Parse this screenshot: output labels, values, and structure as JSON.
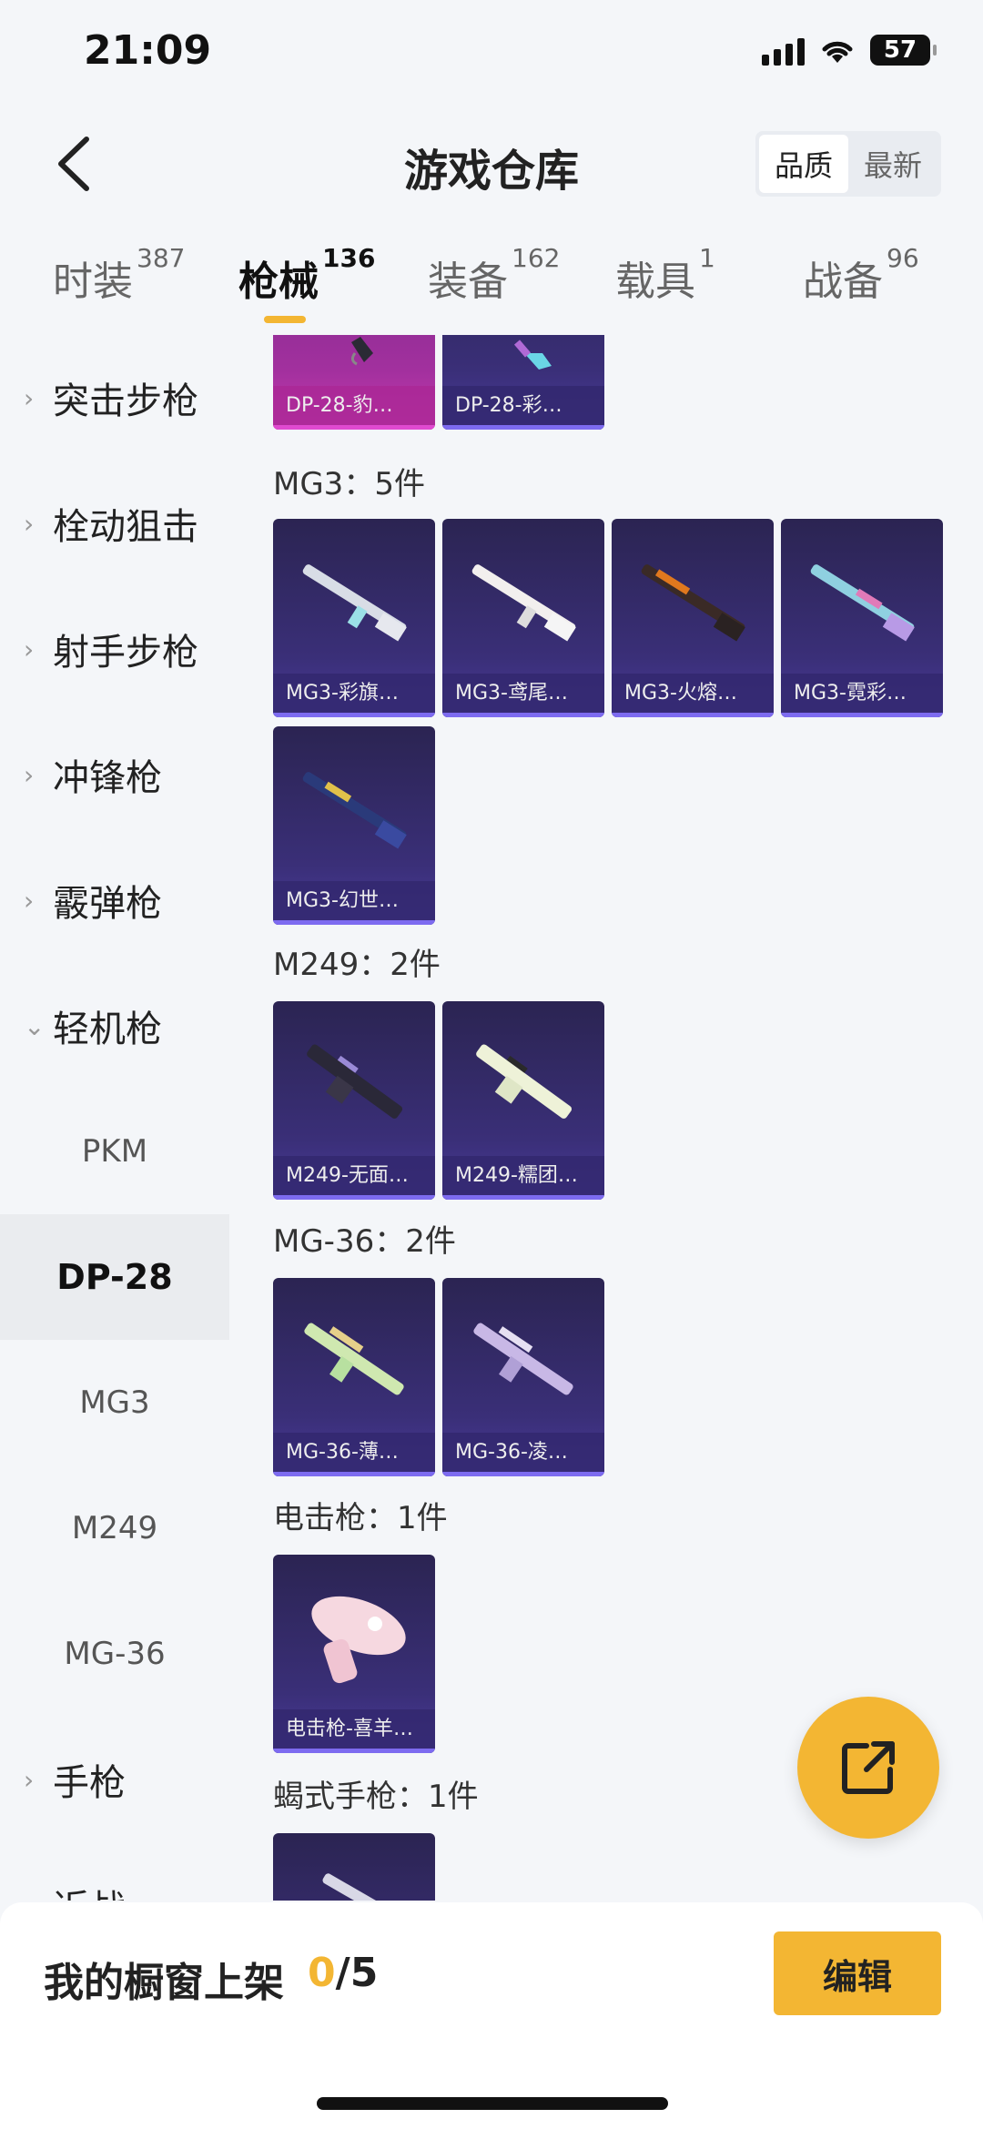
{
  "status": {
    "time": "21:09",
    "battery": "57"
  },
  "header": {
    "title": "游戏仓库",
    "sort": [
      "品质",
      "最新"
    ]
  },
  "tabs": [
    {
      "label": "时装",
      "count": "387"
    },
    {
      "label": "枪械",
      "count": "136"
    },
    {
      "label": "装备",
      "count": "162"
    },
    {
      "label": "载具",
      "count": "1"
    },
    {
      "label": "战备",
      "count": "96"
    }
  ],
  "sidebar": {
    "items": [
      {
        "label": "突击步枪",
        "chev": "›"
      },
      {
        "label": "栓动狙击",
        "chev": "›"
      },
      {
        "label": "射手步枪",
        "chev": "›"
      },
      {
        "label": "冲锋枪",
        "chev": "›"
      },
      {
        "label": "霰弹枪",
        "chev": "›"
      },
      {
        "label": "轻机枪",
        "chev": "⌄"
      },
      {
        "label": "PKM"
      },
      {
        "label": "DP-28"
      },
      {
        "label": "MG3"
      },
      {
        "label": "M249"
      },
      {
        "label": "MG-36"
      },
      {
        "label": "手枪",
        "chev": "›"
      },
      {
        "label": "近战",
        "chev": "›"
      }
    ]
  },
  "groups": {
    "dp28": {
      "cards": [
        "DP-28-豹…",
        "DP-28-彩…"
      ]
    },
    "mg3": {
      "title": "MG3：5件",
      "cards": [
        "MG3-彩旗…",
        "MG3-鸢尾…",
        "MG3-火熔…",
        "MG3-霓彩…",
        "MG3-幻世…"
      ]
    },
    "m249": {
      "title": "M249：2件",
      "cards": [
        "M249-无面…",
        "M249-糯团…"
      ]
    },
    "mg36": {
      "title": "MG-36：2件",
      "cards": [
        "MG-36-薄…",
        "MG-36-凌…"
      ]
    },
    "stun": {
      "title": "电击枪：1件",
      "cards": [
        "电击枪-喜羊…"
      ]
    },
    "scorpion": {
      "title": "蝎式手枪：1件"
    }
  },
  "bottom": {
    "label": "我的橱窗上架",
    "current": "0",
    "total": "/5",
    "edit": "编辑"
  },
  "icons": {
    "back": "chevron-left-icon",
    "share": "external-link-icon"
  },
  "colors": {
    "accent": "#f3b633",
    "card_purple": "#3a2f78",
    "card_pink": "#a2309e"
  }
}
